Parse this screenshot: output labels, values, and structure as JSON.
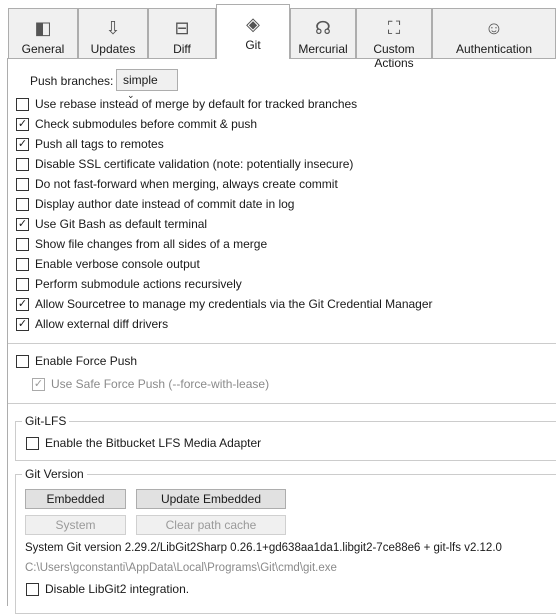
{
  "tabs": [
    {
      "label": "General",
      "icon": "toggle-icon"
    },
    {
      "label": "Updates",
      "icon": "download-icon"
    },
    {
      "label": "Diff",
      "icon": "diff-icon"
    },
    {
      "label": "Git",
      "icon": "git-icon",
      "selected": true
    },
    {
      "label": "Mercurial",
      "icon": "mercurial-icon"
    },
    {
      "label": "Custom Actions",
      "icon": "hierarchy-icon"
    },
    {
      "label": "Authentication",
      "icon": "user-icon"
    }
  ],
  "push_branches": {
    "label": "Push branches:",
    "value": "simple"
  },
  "options": [
    {
      "label": "Use rebase instead of merge by default for tracked branches",
      "checked": false
    },
    {
      "label": "Check submodules before commit & push",
      "checked": true
    },
    {
      "label": "Push all tags to remotes",
      "checked": true
    },
    {
      "label": "Disable SSL certificate validation (note: potentially insecure)",
      "checked": false
    },
    {
      "label": "Do not fast-forward when merging, always create commit",
      "checked": false
    },
    {
      "label": "Display author date instead of commit date in log",
      "checked": false
    },
    {
      "label": "Use Git Bash as default terminal",
      "checked": true
    },
    {
      "label": "Show file changes from all sides of a merge",
      "checked": false
    },
    {
      "label": "Enable verbose console output",
      "checked": false
    },
    {
      "label": "Perform submodule actions recursively",
      "checked": false
    },
    {
      "label": "Allow Sourcetree to manage my credentials via the Git Credential Manager",
      "checked": true
    },
    {
      "label": "Allow external diff drivers",
      "checked": true
    }
  ],
  "force_push": {
    "label": "Enable Force Push",
    "checked": false
  },
  "safe_force_push": {
    "label": "Use Safe Force Push (--force-with-lease)",
    "checked": true,
    "disabled": true
  },
  "git_lfs": {
    "title": "Git-LFS",
    "option": {
      "label": "Enable the Bitbucket LFS Media Adapter",
      "checked": false
    }
  },
  "git_version": {
    "title": "Git Version",
    "embedded": "Embedded",
    "update_embedded": "Update Embedded",
    "system": "System",
    "clear_cache": "Clear path cache",
    "version_text": "System Git version 2.29.2/LibGit2Sharp 0.26.1+gd638aa1da1.libgit2-7ce88e6 + git-lfs v2.12.0",
    "path": "C:\\Users\\gconstanti\\AppData\\Local\\Programs\\Git\\cmd\\git.exe",
    "disable_libgit2": {
      "label": "Disable LibGit2 integration.",
      "checked": false
    }
  }
}
